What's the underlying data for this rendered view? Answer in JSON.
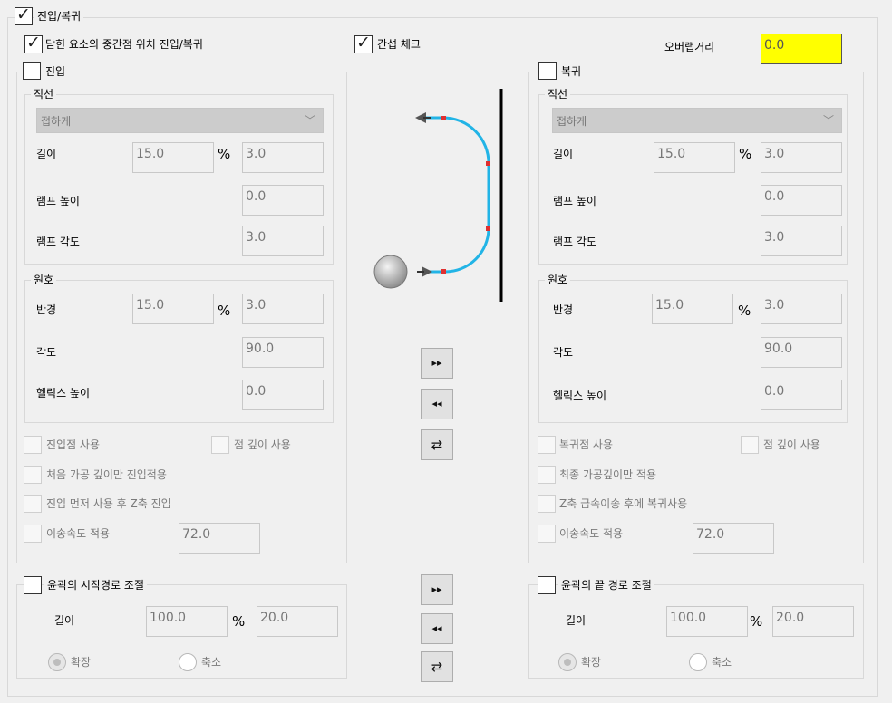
{
  "header": {
    "main_label": "진입/복귀",
    "closed_label": "닫힌 요소의 중간점 위치 진입/복귀",
    "interference_label": "간섭 체크",
    "overlap_label": "오버랩거리",
    "overlap_value": "0.0"
  },
  "colors": {
    "overlap_bg": "#ffff00",
    "path": "#22b4e6",
    "path_points": "#e03030"
  },
  "entry": {
    "title": "진입",
    "line": {
      "title": "직선",
      "select_value": "접하게",
      "length_label": "길이",
      "length_value": "15.0",
      "length_pct": "3.0",
      "pct_symbol": "%",
      "ramp_height_label": "램프 높이",
      "ramp_height_value": "0.0",
      "ramp_angle_label": "램프 각도",
      "ramp_angle_value": "3.0"
    },
    "arc": {
      "title": "원호",
      "radius_label": "반경",
      "radius_value": "15.0",
      "radius_pct": "3.0",
      "pct_symbol": "%",
      "angle_label": "각도",
      "angle_value": "90.0",
      "helix_label": "헬릭스 높이",
      "helix_value": "0.0"
    },
    "opt_point": "진입점 사용",
    "opt_depth": "점 깊이 사용",
    "opt_first_depth": "처음 가공 깊이만 진입적용",
    "opt_zfirst": "진입 먼저 사용 후 Z축 진입",
    "opt_feed": "이송속도 적용",
    "feed_value": "72.0"
  },
  "exit": {
    "title": "복귀",
    "line": {
      "title": "직선",
      "select_value": "접하게",
      "length_label": "길이",
      "length_value": "15.0",
      "length_pct": "3.0",
      "pct_symbol": "%",
      "ramp_height_label": "램프 높이",
      "ramp_height_value": "0.0",
      "ramp_angle_label": "램프 각도",
      "ramp_angle_value": "3.0"
    },
    "arc": {
      "title": "원호",
      "radius_label": "반경",
      "radius_value": "15.0",
      "radius_pct": "3.0",
      "pct_symbol": "%",
      "angle_label": "각도",
      "angle_value": "90.0",
      "helix_label": "헬릭스 높이",
      "helix_value": "0.0"
    },
    "opt_point": "복귀점 사용",
    "opt_depth": "점 깊이 사용",
    "opt_last_depth": "최종 가공깊이만 적용",
    "opt_zrapid": "Z축 급속이송 후에 복귀사용",
    "opt_feed": "이송속도 적용",
    "feed_value": "72.0"
  },
  "start_adjust": {
    "title": "윤곽의 시작경로 조절",
    "length_label": "길이",
    "length_value": "100.0",
    "pct_symbol": "%",
    "pct_value": "20.0",
    "extend_label": "확장",
    "shrink_label": "축소"
  },
  "end_adjust": {
    "title": "윤곽의 끝 경로 조절",
    "length_label": "길이",
    "length_value": "100.0",
    "pct_symbol": "%",
    "pct_value": "20.0",
    "extend_label": "확장",
    "shrink_label": "축소"
  },
  "buttons": {
    "copy_right": "▸▸",
    "copy_left": "◂◂",
    "swap": "⇄"
  }
}
